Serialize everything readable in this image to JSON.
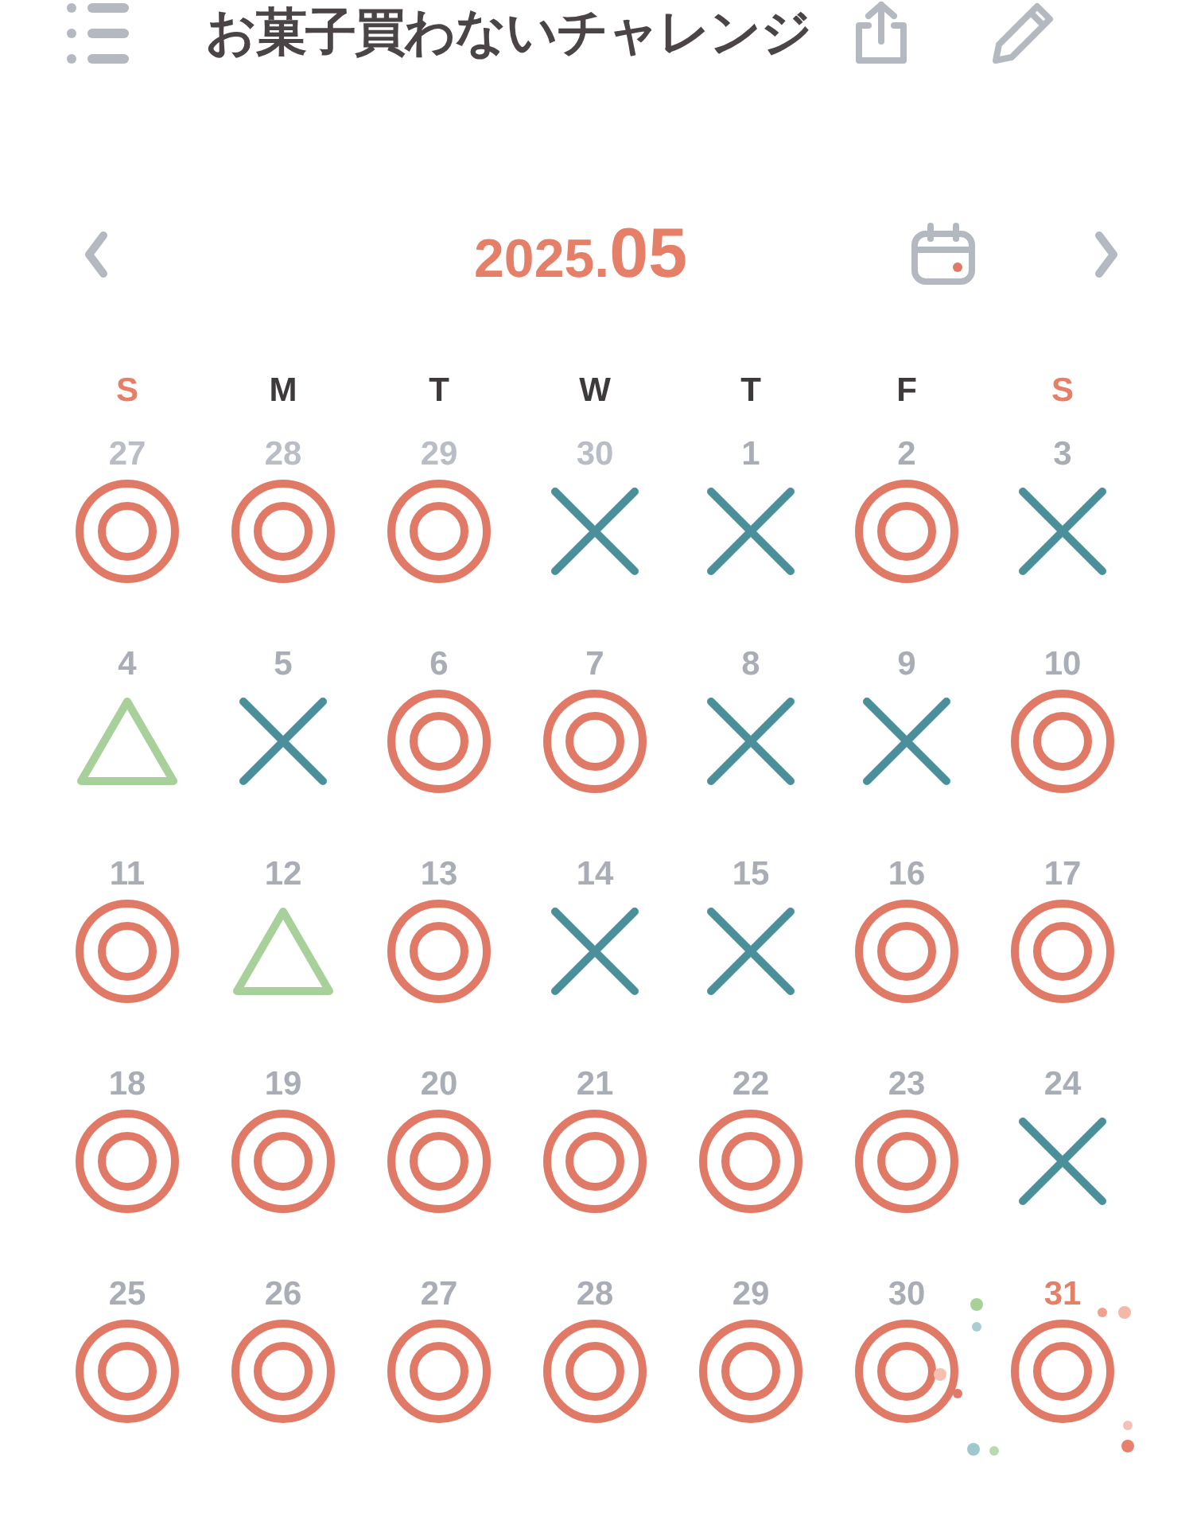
{
  "header": {
    "title": "お菓子買わないチャレンジ"
  },
  "month": {
    "year": "2025.",
    "month": "05"
  },
  "weekdays": [
    {
      "label": "S",
      "weekend": true
    },
    {
      "label": "M",
      "weekend": false
    },
    {
      "label": "T",
      "weekend": false
    },
    {
      "label": "W",
      "weekend": false
    },
    {
      "label": "T",
      "weekend": false
    },
    {
      "label": "F",
      "weekend": false
    },
    {
      "label": "S",
      "weekend": true
    }
  ],
  "weeks": [
    [
      {
        "day": "27",
        "in_month": false,
        "today": false,
        "kind": "double_circle"
      },
      {
        "day": "28",
        "in_month": false,
        "today": false,
        "kind": "double_circle"
      },
      {
        "day": "29",
        "in_month": false,
        "today": false,
        "kind": "double_circle"
      },
      {
        "day": "30",
        "in_month": false,
        "today": false,
        "kind": "cross"
      },
      {
        "day": "1",
        "in_month": true,
        "today": false,
        "kind": "cross"
      },
      {
        "day": "2",
        "in_month": true,
        "today": false,
        "kind": "double_circle"
      },
      {
        "day": "3",
        "in_month": true,
        "today": false,
        "kind": "cross"
      }
    ],
    [
      {
        "day": "4",
        "in_month": true,
        "today": false,
        "kind": "triangle"
      },
      {
        "day": "5",
        "in_month": true,
        "today": false,
        "kind": "cross"
      },
      {
        "day": "6",
        "in_month": true,
        "today": false,
        "kind": "double_circle"
      },
      {
        "day": "7",
        "in_month": true,
        "today": false,
        "kind": "double_circle"
      },
      {
        "day": "8",
        "in_month": true,
        "today": false,
        "kind": "cross"
      },
      {
        "day": "9",
        "in_month": true,
        "today": false,
        "kind": "cross"
      },
      {
        "day": "10",
        "in_month": true,
        "today": false,
        "kind": "double_circle"
      }
    ],
    [
      {
        "day": "11",
        "in_month": true,
        "today": false,
        "kind": "double_circle"
      },
      {
        "day": "12",
        "in_month": true,
        "today": false,
        "kind": "triangle"
      },
      {
        "day": "13",
        "in_month": true,
        "today": false,
        "kind": "double_circle"
      },
      {
        "day": "14",
        "in_month": true,
        "today": false,
        "kind": "cross"
      },
      {
        "day": "15",
        "in_month": true,
        "today": false,
        "kind": "cross"
      },
      {
        "day": "16",
        "in_month": true,
        "today": false,
        "kind": "double_circle"
      },
      {
        "day": "17",
        "in_month": true,
        "today": false,
        "kind": "double_circle"
      }
    ],
    [
      {
        "day": "18",
        "in_month": true,
        "today": false,
        "kind": "double_circle"
      },
      {
        "day": "19",
        "in_month": true,
        "today": false,
        "kind": "double_circle"
      },
      {
        "day": "20",
        "in_month": true,
        "today": false,
        "kind": "double_circle"
      },
      {
        "day": "21",
        "in_month": true,
        "today": false,
        "kind": "double_circle"
      },
      {
        "day": "22",
        "in_month": true,
        "today": false,
        "kind": "double_circle"
      },
      {
        "day": "23",
        "in_month": true,
        "today": false,
        "kind": "double_circle"
      },
      {
        "day": "24",
        "in_month": true,
        "today": false,
        "kind": "cross"
      }
    ],
    [
      {
        "day": "25",
        "in_month": true,
        "today": false,
        "kind": "double_circle"
      },
      {
        "day": "26",
        "in_month": true,
        "today": false,
        "kind": "double_circle"
      },
      {
        "day": "27",
        "in_month": true,
        "today": false,
        "kind": "double_circle"
      },
      {
        "day": "28",
        "in_month": true,
        "today": false,
        "kind": "double_circle"
      },
      {
        "day": "29",
        "in_month": true,
        "today": false,
        "kind": "double_circle"
      },
      {
        "day": "30",
        "in_month": true,
        "today": false,
        "kind": "double_circle"
      },
      {
        "day": "31",
        "in_month": true,
        "today": true,
        "kind": "double_circle"
      }
    ]
  ]
}
